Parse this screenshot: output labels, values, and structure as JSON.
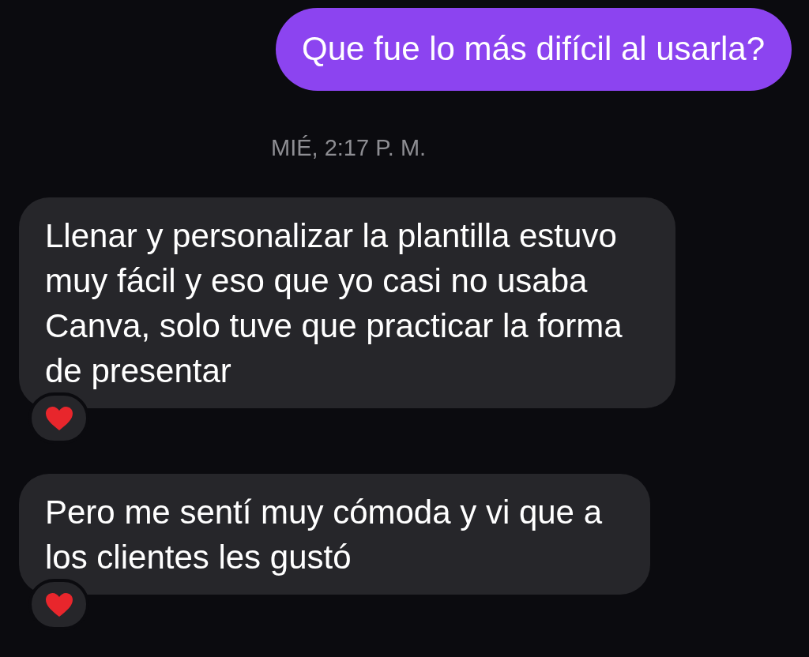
{
  "messages": [
    {
      "kind": "outgoing",
      "text": "Que fue lo más difícil al usarla?"
    },
    {
      "kind": "timestamp",
      "text": "MIÉ, 2:17 P. M."
    },
    {
      "kind": "incoming",
      "text": "Llenar y personalizar la plantilla estuvo muy fácil y eso que yo casi no usaba Canva, solo tuve que practicar la forma de presentar",
      "hearted": true
    },
    {
      "kind": "incoming",
      "text": "Pero me sentí muy cómoda y vi que a los clientes les gustó",
      "hearted": true
    }
  ]
}
